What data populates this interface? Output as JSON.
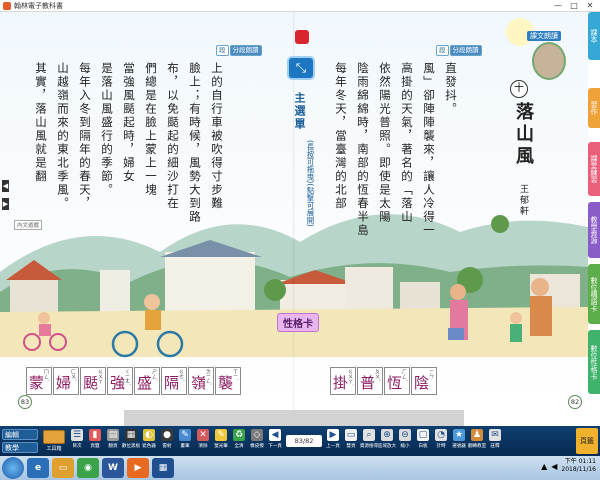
{
  "window": {
    "title": "翰林電子教科書",
    "controls": [
      "—",
      "□",
      "✕"
    ]
  },
  "left_page": {
    "section_tags": [
      "段",
      "分段朗讀"
    ],
    "columns": [
      "其實，落山風就是翻",
      "山越嶺而來的東北季風。",
      "每年入冬到隔年的春天，",
      "是落山風盛行的季節。",
      "當強風颳起時，婦女",
      "們總是在臉上蒙上一塊",
      "布，以免颳起的細沙打在",
      "臉上；有時候，風勢大到路",
      "上的自行車被吹得寸步難"
    ],
    "side_note": "內文遊戲",
    "page_number": "83"
  },
  "right_page": {
    "lesson_tag": "課文朗讀",
    "lesson_number": "十",
    "lesson_title": "落山風",
    "author": "王郁軒",
    "section_tags": [
      "段",
      "分段朗讀"
    ],
    "columns": [
      "每年冬天，當臺灣的北部",
      "陰雨綿綿時，南部的恆春半島",
      "依然陽光普照。即使是太陽",
      "高掛的天氣，著名的「落山",
      "風」卻陣陣襲來，讓人冷得一",
      "直發抖。"
    ],
    "page_number": "82"
  },
  "main_menu": {
    "label": "主選單",
    "hint": "(長按可拖曳)(點擊可展開)"
  },
  "trait_card": "性格卡",
  "vocab_left": [
    {
      "ch": "蒙",
      "zy": "ㄇㄥˊ"
    },
    {
      "ch": "婦",
      "zy": "ㄈㄨˋ"
    },
    {
      "ch": "颳",
      "zy": "ㄍㄨㄚ"
    },
    {
      "ch": "強",
      "zy": "ㄑㄧㄤˊ"
    },
    {
      "ch": "盛",
      "zy": "ㄕㄥˋ"
    },
    {
      "ch": "隔",
      "zy": "ㄍㄜˊ"
    },
    {
      "ch": "嶺",
      "zy": "ㄌㄧㄥˇ"
    },
    {
      "ch": "襲",
      "zy": "ㄒㄧˊ"
    }
  ],
  "vocab_right": [
    {
      "ch": "掛",
      "zy": "ㄍㄨㄚˋ"
    },
    {
      "ch": "普",
      "zy": "ㄆㄨˇ"
    },
    {
      "ch": "恆",
      "zy": "ㄏㄥˊ"
    },
    {
      "ch": "陰",
      "zy": "ㄧㄣ"
    }
  ],
  "side_tabs": [
    {
      "label": "課本",
      "color": "#35a8d6"
    },
    {
      "label": "習作",
      "color": "#f0a23a"
    },
    {
      "label": "課堂練習",
      "color": "#e8607a"
    },
    {
      "label": "教學資源",
      "color": "#8a5cc7"
    },
    {
      "label": "數位構語卡",
      "color": "#5cae4a"
    },
    {
      "label": "數位性格卡",
      "color": "#3fb36c"
    }
  ],
  "toolbar": {
    "mode_buttons": [
      "編輯",
      "教學"
    ],
    "toolbox_label": "工具箱",
    "buttons": [
      {
        "label": "目次",
        "color": "#e1e1e1",
        "glyph": "☰"
      },
      {
        "label": "頁籤",
        "color": "#e25b5b",
        "glyph": "▮"
      },
      {
        "label": "翻頁",
        "color": "#9a9a9a",
        "glyph": "▤"
      },
      {
        "label": "數位黑板",
        "color": "#333333",
        "glyph": "▦"
      },
      {
        "label": "遮色器",
        "color": "#e2c23a",
        "glyph": "◐"
      },
      {
        "label": "雷射",
        "color": "#3a3a3a",
        "glyph": "●"
      },
      {
        "label": "畫筆",
        "color": "#4a8ad0",
        "glyph": "✎"
      },
      {
        "label": "清除",
        "color": "#d25a5a",
        "glyph": "✕"
      },
      {
        "label": "螢光筆",
        "color": "#f0c83a",
        "glyph": "✎"
      },
      {
        "label": "全清",
        "color": "#3aa34a",
        "glyph": "♻"
      },
      {
        "label": "橡皮擦",
        "color": "#7a7a7a",
        "glyph": "◇"
      },
      {
        "label": "下一頁",
        "color": "#ffffff",
        "glyph": "◀"
      }
    ],
    "page_value": "83/82",
    "buttons_after": [
      {
        "label": "上一頁",
        "color": "#ffffff",
        "glyph": "▶"
      },
      {
        "label": "雙頁",
        "color": "#f1f1f1",
        "glyph": "▭"
      },
      {
        "label": "資源搜尋",
        "color": "#e2e2e2",
        "glyph": "⌕"
      },
      {
        "label": "區域放大",
        "color": "#dcdcdc",
        "glyph": "⊕"
      },
      {
        "label": "縮小",
        "color": "#dcdcdc",
        "glyph": "⊖"
      },
      {
        "label": "白板",
        "color": "#f3f3f3",
        "glyph": "▢"
      },
      {
        "label": "計時",
        "color": "#e2e2e2",
        "glyph": "◔"
      },
      {
        "label": "選號器",
        "color": "#4a9ad8",
        "glyph": "★"
      },
      {
        "label": "翻轉教室",
        "color": "#d68b3a",
        "glyph": "♟"
      },
      {
        "label": "註釋",
        "color": "#e2e2e2",
        "glyph": "✉"
      }
    ],
    "page_button": "頁籤"
  },
  "taskbar": {
    "time": "下午 01:11",
    "date": "2018/11/16"
  }
}
